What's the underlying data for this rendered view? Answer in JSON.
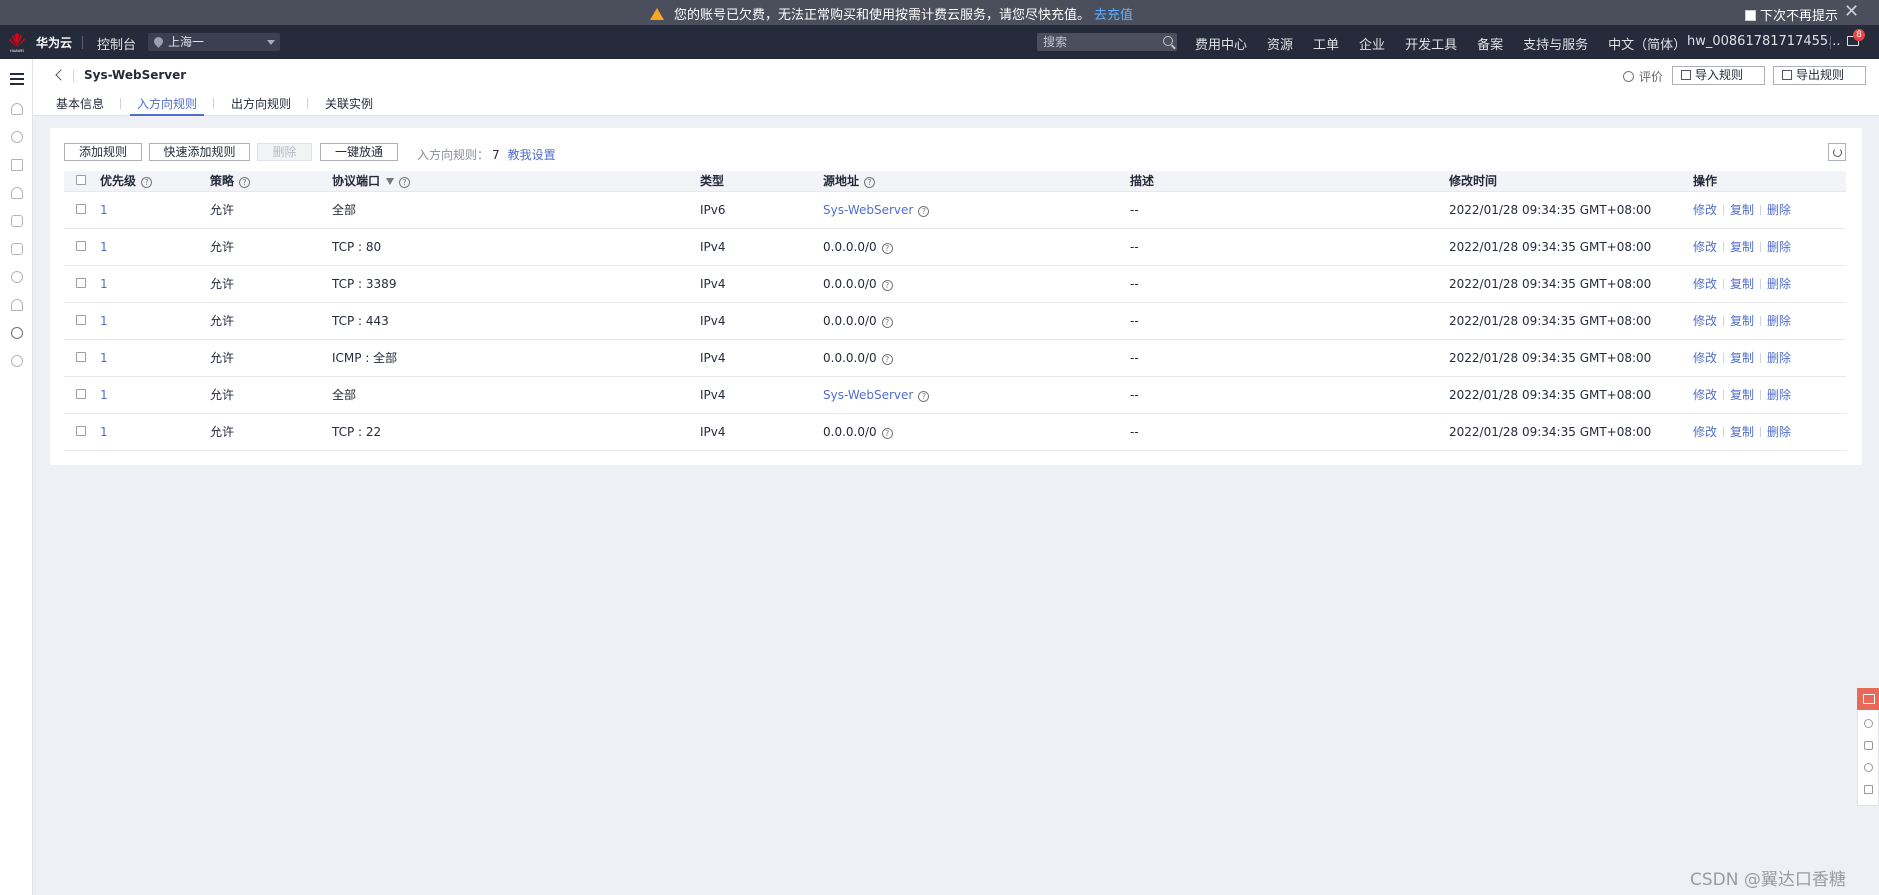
{
  "banner": {
    "message": "您的账号已欠费，无法正常购买和使用按需计费云服务，请您尽快充值。",
    "link": "去充值",
    "dont_show": "下次不再提示"
  },
  "topnav": {
    "brand": "华为云",
    "console": "控制台",
    "region": "上海一",
    "search_placeholder": "搜索",
    "items": [
      "费用中心",
      "资源",
      "工单",
      "企业",
      "开发工具",
      "备案",
      "支持与服务",
      "中文（简体）"
    ],
    "user": "hw_00861781717455...",
    "badge": "8"
  },
  "header": {
    "title": "Sys-WebServer",
    "rate": "评价",
    "import": "导入规则",
    "export": "导出规则",
    "tabs": [
      "基本信息",
      "入方向规则",
      "出方向规则",
      "关联实例"
    ]
  },
  "toolbar": {
    "add": "添加规则",
    "quick_add": "快速添加规则",
    "delete": "删除",
    "allow_all": "一键放通",
    "count_label": "入方向规则：",
    "count": "7",
    "help": "教我设置"
  },
  "table": {
    "columns": [
      "优先级",
      "策略",
      "协议端口",
      "类型",
      "源地址",
      "描述",
      "修改时间",
      "操作"
    ],
    "ops": [
      "修改",
      "复制",
      "删除"
    ],
    "rows": [
      {
        "priority": "1",
        "policy": "允许",
        "port": "全部",
        "type": "IPv6",
        "source": "Sys-WebServer",
        "source_link": true,
        "desc": "--",
        "time": "2022/01/28 09:34:35 GMT+08:00"
      },
      {
        "priority": "1",
        "policy": "允许",
        "port": "TCP : 80",
        "type": "IPv4",
        "source": "0.0.0.0/0",
        "source_link": false,
        "desc": "--",
        "time": "2022/01/28 09:34:35 GMT+08:00"
      },
      {
        "priority": "1",
        "policy": "允许",
        "port": "TCP : 3389",
        "type": "IPv4",
        "source": "0.0.0.0/0",
        "source_link": false,
        "desc": "--",
        "time": "2022/01/28 09:34:35 GMT+08:00"
      },
      {
        "priority": "1",
        "policy": "允许",
        "port": "TCP : 443",
        "type": "IPv4",
        "source": "0.0.0.0/0",
        "source_link": false,
        "desc": "--",
        "time": "2022/01/28 09:34:35 GMT+08:00"
      },
      {
        "priority": "1",
        "policy": "允许",
        "port": "ICMP : 全部",
        "type": "IPv4",
        "source": "0.0.0.0/0",
        "source_link": false,
        "desc": "--",
        "time": "2022/01/28 09:34:35 GMT+08:00"
      },
      {
        "priority": "1",
        "policy": "允许",
        "port": "全部",
        "type": "IPv4",
        "source": "Sys-WebServer",
        "source_link": true,
        "desc": "--",
        "time": "2022/01/28 09:34:35 GMT+08:00"
      },
      {
        "priority": "1",
        "policy": "允许",
        "port": "TCP : 22",
        "type": "IPv4",
        "source": "0.0.0.0/0",
        "source_link": false,
        "desc": "--",
        "time": "2022/01/28 09:34:35 GMT+08:00"
      }
    ]
  },
  "watermark": "CSDN @翼达口香糖",
  "colors": {
    "accent": "#526ecc",
    "topnav_bg": "#252b3a",
    "banner_bg": "#4b4f5c",
    "warning": "#f5a623",
    "brand_red": "#e60012"
  }
}
